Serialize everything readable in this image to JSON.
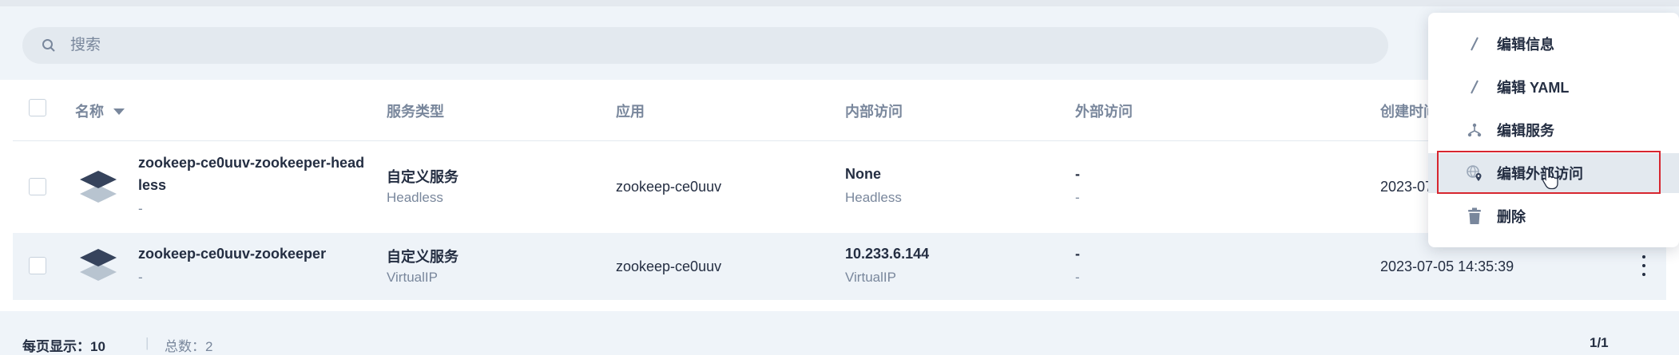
{
  "search": {
    "placeholder": "搜索"
  },
  "table": {
    "columns": {
      "name": "名称",
      "service_type": "服务类型",
      "app": "应用",
      "internal_access": "内部访问",
      "external_access": "外部访问",
      "created": "创建时间"
    },
    "rows": [
      {
        "name_line1": "zookeep-ce0uuv-zookeeper-head",
        "name_line2": "less",
        "desc": "-",
        "service_type": "自定义服务",
        "service_sub": "Headless",
        "app": "zookeep-ce0uuv",
        "internal": "None",
        "internal_sub": "Headless",
        "external": "-",
        "external_sub": "-",
        "created": "2023-07"
      },
      {
        "name": "zookeep-ce0uuv-zookeeper",
        "desc": "-",
        "service_type": "自定义服务",
        "service_sub": "VirtualIP",
        "app": "zookeep-ce0uuv",
        "internal": "10.233.6.144",
        "internal_sub": "VirtualIP",
        "external": "-",
        "external_sub": "-",
        "created": "2023-07-05 14:35:39"
      }
    ]
  },
  "footer": {
    "per_page": "每页显示：10",
    "total": "总数：2",
    "pages": "1/1"
  },
  "menu": {
    "items": [
      {
        "label": "编辑信息",
        "icon": "pencil-icon"
      },
      {
        "label": "编辑 YAML",
        "icon": "pencil-icon"
      },
      {
        "label": "编辑服务",
        "icon": "service-topology-icon"
      },
      {
        "label": "编辑外部访问",
        "icon": "external-access-icon"
      },
      {
        "label": "删除",
        "icon": "trash-icon"
      }
    ]
  },
  "colors": {
    "highlight_border": "#d7262f",
    "text": "#242e42",
    "muted": "#79879c",
    "background": "#eff4f9"
  }
}
